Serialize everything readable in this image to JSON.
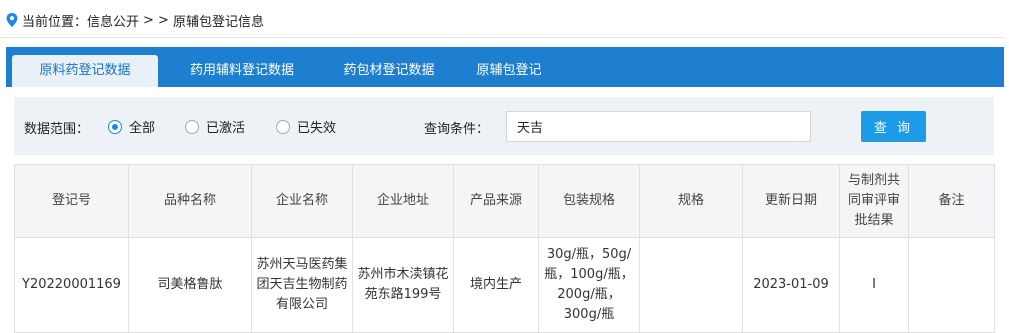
{
  "breadcrumb": {
    "icon": "location-pin-icon",
    "current_label": "当前位置：",
    "section": "信息公开",
    "separator": "> >",
    "page": "原辅包登记信息"
  },
  "tabs": [
    {
      "label": "原料药登记数据",
      "active": true
    },
    {
      "label": "药用辅料登记数据",
      "active": false
    },
    {
      "label": "药包材登记数据",
      "active": false
    },
    {
      "label": "原辅包登记",
      "active": false
    }
  ],
  "filter": {
    "scope_label": "数据范围：",
    "options": [
      {
        "label": "全部",
        "checked": true
      },
      {
        "label": "已激活",
        "checked": false
      },
      {
        "label": "已失效",
        "checked": false
      }
    ],
    "query_label": "查询条件：",
    "query_value": "天吉",
    "button_label": "查 询"
  },
  "table": {
    "headers": [
      "登记号",
      "品种名称",
      "企业名称",
      "企业地址",
      "产品来源",
      "包装规格",
      "规格",
      "更新日期",
      "与制剂共同审评审批结果",
      "备注"
    ],
    "rows": [
      [
        "Y20220001169",
        "司美格鲁肽",
        "苏州天马医药集团天吉生物制药有限公司",
        "苏州市木渎镇花苑东路199号",
        "境内生产",
        "30g/瓶，50g/瓶，100g/瓶，200g/瓶，300g/瓶",
        "",
        "2023-01-09",
        "I",
        ""
      ]
    ]
  },
  "colors": {
    "tab_bar": "#1e7fd0",
    "active_tab_text": "#1a73c9",
    "button": "#1e9be6",
    "radio_checked": "#1e88e5"
  }
}
